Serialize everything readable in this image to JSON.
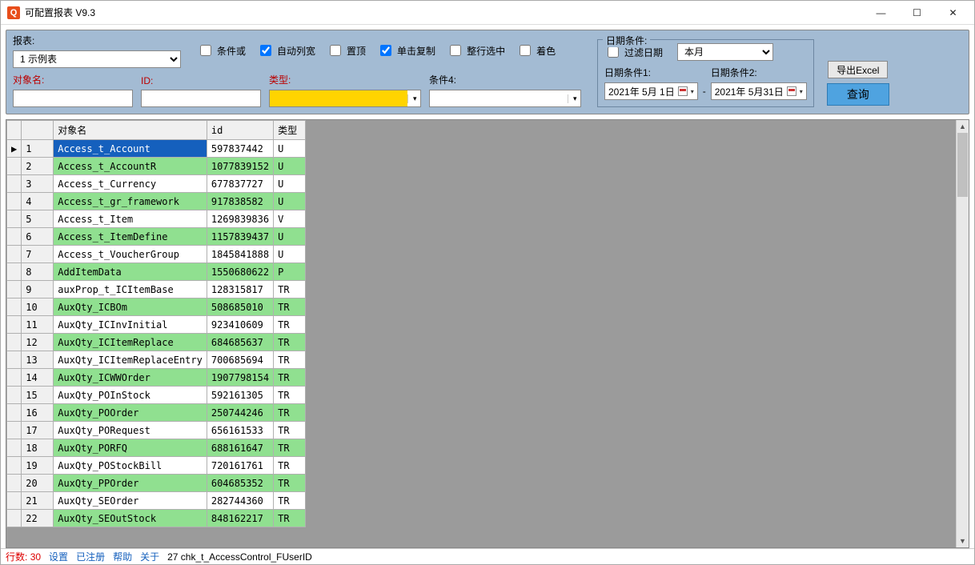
{
  "window": {
    "title": "可配置报表 V9.3"
  },
  "panel": {
    "report_lbl": "报表:",
    "report_value": "1 示例表",
    "checks": {
      "cond_or": "条件或",
      "auto_width": "自动列宽",
      "pin_top": "置顶",
      "click_copy": "单击复制",
      "full_row": "整行选中",
      "colorize": "着色"
    },
    "obj_lbl": "对象名:",
    "id_lbl": "ID:",
    "type_lbl": "类型:",
    "cond4_lbl": "条件4:",
    "date_legend": "日期条件:",
    "filter_date": "过滤日期",
    "month_select": "本月",
    "date1_lbl": "日期条件1:",
    "date1_val": "2021年 5月 1日",
    "date2_lbl": "日期条件2:",
    "date2_val": "2021年 5月31日",
    "sep": "-",
    "export_btn": "导出Excel",
    "query_btn": "查询"
  },
  "grid": {
    "headers": {
      "obj": "对象名",
      "id": "id",
      "type": "类型"
    },
    "rows": [
      {
        "n": "1",
        "obj": "Access_t_Account",
        "id": "597837442",
        "type": "U"
      },
      {
        "n": "2",
        "obj": "Access_t_AccountR",
        "id": "1077839152",
        "type": "U"
      },
      {
        "n": "3",
        "obj": "Access_t_Currency",
        "id": "677837727",
        "type": "U"
      },
      {
        "n": "4",
        "obj": "Access_t_gr_framework",
        "id": "917838582",
        "type": "U"
      },
      {
        "n": "5",
        "obj": "Access_t_Item",
        "id": "1269839836",
        "type": "V"
      },
      {
        "n": "6",
        "obj": "Access_t_ItemDefine",
        "id": "1157839437",
        "type": "U"
      },
      {
        "n": "7",
        "obj": "Access_t_VoucherGroup",
        "id": "1845841888",
        "type": "U"
      },
      {
        "n": "8",
        "obj": "AddItemData",
        "id": "1550680622",
        "type": "P"
      },
      {
        "n": "9",
        "obj": "auxProp_t_ICItemBase",
        "id": "128315817",
        "type": "TR"
      },
      {
        "n": "10",
        "obj": "AuxQty_ICBOm",
        "id": "508685010",
        "type": "TR"
      },
      {
        "n": "11",
        "obj": "AuxQty_ICInvInitial",
        "id": "923410609",
        "type": "TR"
      },
      {
        "n": "12",
        "obj": "AuxQty_ICItemReplace",
        "id": "684685637",
        "type": "TR"
      },
      {
        "n": "13",
        "obj": "AuxQty_ICItemReplaceEntry",
        "id": "700685694",
        "type": "TR"
      },
      {
        "n": "14",
        "obj": "AuxQty_ICWWOrder",
        "id": "1907798154",
        "type": "TR"
      },
      {
        "n": "15",
        "obj": "AuxQty_POInStock",
        "id": "592161305",
        "type": "TR"
      },
      {
        "n": "16",
        "obj": "AuxQty_POOrder",
        "id": "250744246",
        "type": "TR"
      },
      {
        "n": "17",
        "obj": "AuxQty_PORequest",
        "id": "656161533",
        "type": "TR"
      },
      {
        "n": "18",
        "obj": "AuxQty_PORFQ",
        "id": "688161647",
        "type": "TR"
      },
      {
        "n": "19",
        "obj": "AuxQty_POStockBill",
        "id": "720161761",
        "type": "TR"
      },
      {
        "n": "20",
        "obj": "AuxQty_PPOrder",
        "id": "604685352",
        "type": "TR"
      },
      {
        "n": "21",
        "obj": "AuxQty_SEOrder",
        "id": "282744360",
        "type": "TR"
      },
      {
        "n": "22",
        "obj": "AuxQty_SEOutStock",
        "id": "848162217",
        "type": "TR"
      }
    ]
  },
  "status": {
    "rows_lbl": "行数:",
    "rows_val": "30",
    "settings": "设置",
    "registered": "已注册",
    "help": "帮助",
    "about": "关于",
    "extra": "27 chk_t_AccessControl_FUserID"
  }
}
